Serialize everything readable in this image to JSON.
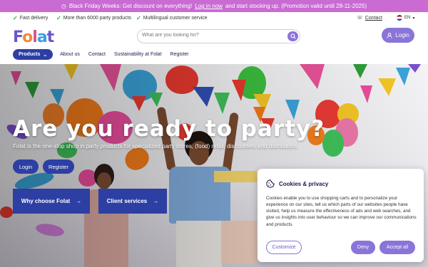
{
  "promo": {
    "prefix": "Black Friday Weeks: Get discount on everything!",
    "link": "Log in now",
    "suffix": "and start stocking up. (Promotion valid until 28-11-2025)"
  },
  "usp": [
    "Fast delivery",
    "More than 6000 party products",
    "Multilingual customer service"
  ],
  "contact_label": "Contact",
  "language": "EN",
  "logo_text": [
    "F",
    "o",
    "l",
    "a",
    "t"
  ],
  "search": {
    "placeholder": "What are you looking for?"
  },
  "login_label": "Login",
  "nav": {
    "products": "Products",
    "links": [
      "About us",
      "Contact",
      "Sustainability at Folat",
      "Register"
    ]
  },
  "hero": {
    "title": "Are you ready to party?",
    "subtitle": "Folat is the one-stop shop in party products for specialized party stores, (food) retail, discounters and distributors.",
    "login": "Login",
    "register": "Register",
    "tile_why": "Why choose Folat",
    "tile_services": "Client services",
    "arrow": "→"
  },
  "cookie": {
    "title": "Cookies & privacy",
    "body": "Cookies enable you to use shopping carts and to personalize your experience on our sites, tell us which parts of our websites people have visited, help us measure the effectiveness of ads and web searches, and give us insights into user behaviour so we can improve our communications and products.",
    "customize": "Customize",
    "deny": "Deny",
    "accept": "Accept all"
  },
  "colors": {
    "promo_bg": "#c96bd2",
    "brand_blue": "#2d3fa3",
    "brand_purple": "#8a74d8"
  }
}
